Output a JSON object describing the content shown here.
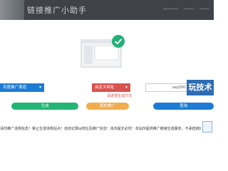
{
  "header": {
    "title": "链接推广小助手",
    "nav": [
      "———",
      "——",
      "——"
    ]
  },
  "selects": {
    "first": "百度推广渠道",
    "second": "自定义网址"
  },
  "hint": "请选择生成方式",
  "url_field": {
    "value": "asp300.net"
  },
  "watermark": "玩技术",
  "buttons": {
    "generate": "生成",
    "mine": "我的推广",
    "query": "查询"
  },
  "notice": "请勿推广违规信息！禁止生成违规站点！自动记录ip地址及推广信息！违法提交必究！本站仅提供推广链接生成服务，不承担链接内容相关责任，请勿用于非法用途。"
}
